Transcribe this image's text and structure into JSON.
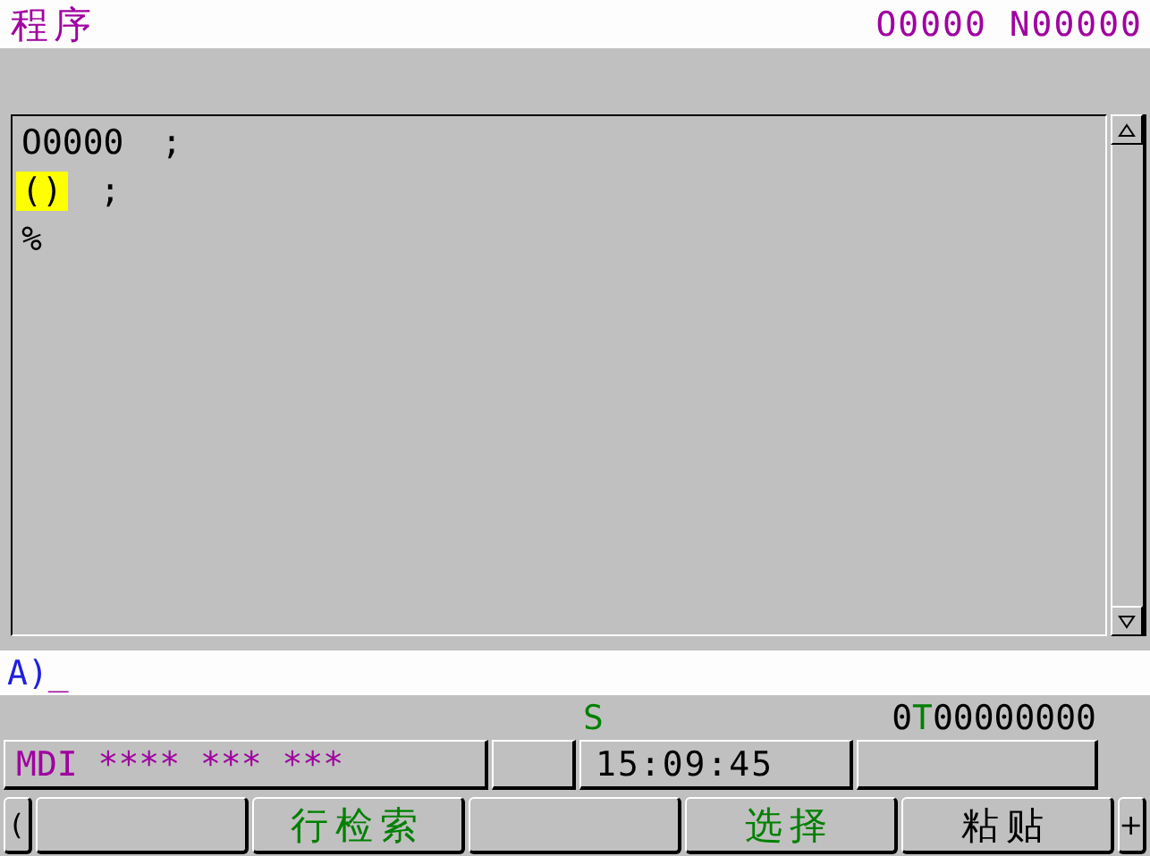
{
  "title_bar": {
    "title": "程序",
    "program_number": "O0000 N00000"
  },
  "program_lines": [
    {
      "code": "O0000",
      "end": ";",
      "selected": false
    },
    {
      "code": "()",
      "end": ";",
      "selected": true
    },
    {
      "code": "%",
      "selected": false
    }
  ],
  "input_line": {
    "prompt": "A)",
    "cursor": "_"
  },
  "info_row": {
    "spindle": "S",
    "prefix": "0",
    "tool_label": "T",
    "tool_value": "00000000"
  },
  "status_row": {
    "mode": "MDI  ****  ***  ***",
    "time": "15:09:45"
  },
  "softkeys": [
    {
      "kind": "edge",
      "label": "(",
      "color": "#000000"
    },
    {
      "kind": "blank"
    },
    {
      "kind": "key",
      "label": "行检索",
      "color": "#008000"
    },
    {
      "kind": "blank"
    },
    {
      "kind": "key",
      "label": "选择",
      "color": "#008000"
    },
    {
      "kind": "key",
      "label": "粘贴",
      "color": "#000000"
    },
    {
      "kind": "edge",
      "label": "+",
      "color": "#000000"
    }
  ]
}
